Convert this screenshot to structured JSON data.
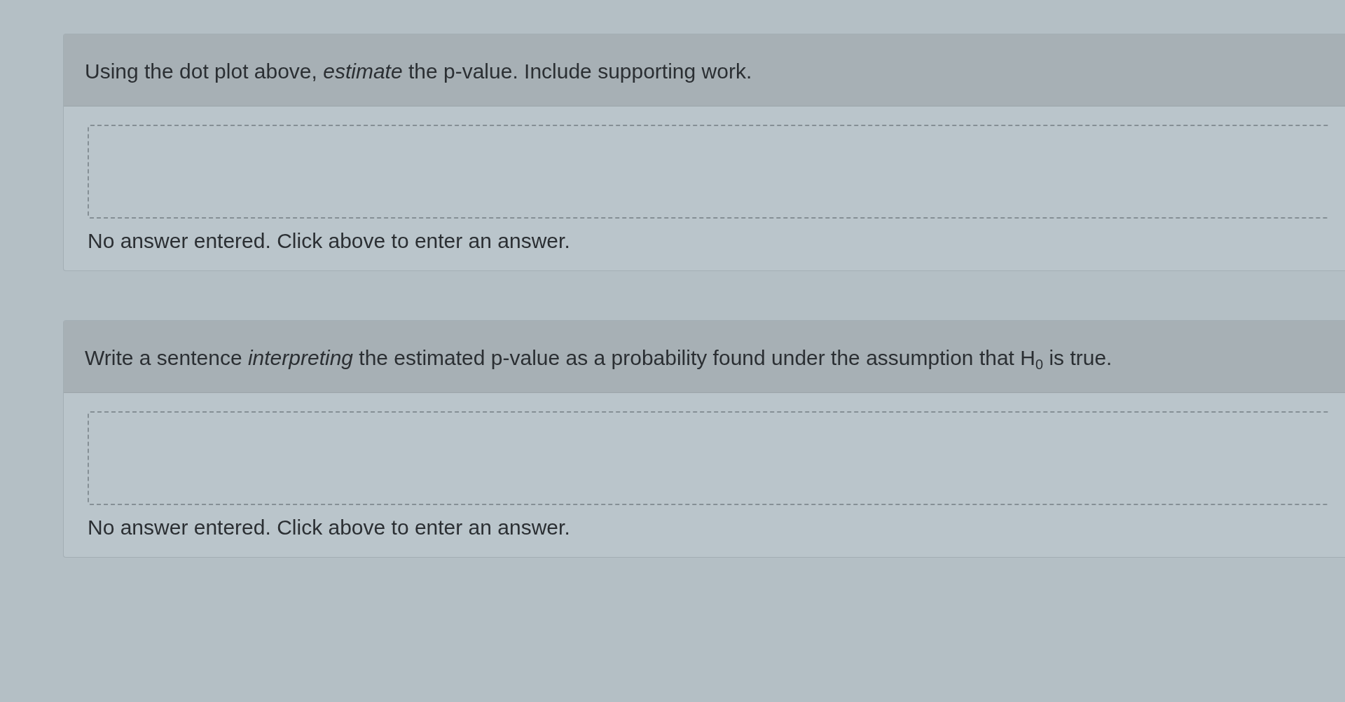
{
  "questions": [
    {
      "prompt": "Using the dot plot above, *estimate* the p-value. Include supporting work.",
      "answer_status": "No answer entered. Click above to enter an answer."
    },
    {
      "prompt": "Write a sentence *interpreting* the estimated p-value as a probability found under the assumption that H$_{0}$ is true.",
      "answer_status": "No answer entered. Click above to enter an answer."
    }
  ]
}
